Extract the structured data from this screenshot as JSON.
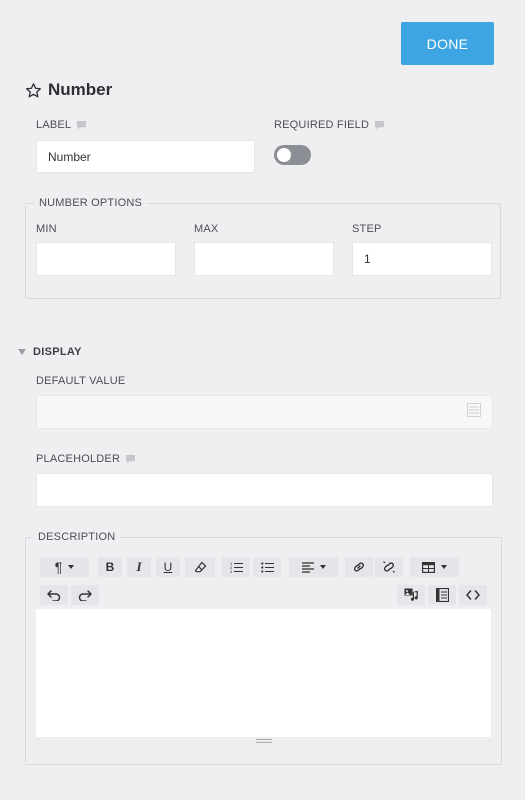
{
  "header": {
    "done_label": "DONE"
  },
  "field": {
    "title": "Number",
    "star_icon": "star-outline-icon",
    "label_caption": "LABEL",
    "label_value": "Number",
    "required_caption": "REQUIRED FIELD",
    "required_on": false
  },
  "number_options": {
    "legend": "NUMBER OPTIONS",
    "min_caption": "MIN",
    "min_value": "",
    "max_caption": "MAX",
    "max_value": "",
    "step_caption": "STEP",
    "step_value": "1"
  },
  "display": {
    "section_label": "DISPLAY",
    "default_caption": "DEFAULT VALUE",
    "default_value": "",
    "placeholder_caption": "PLACEHOLDER",
    "placeholder_value": ""
  },
  "description": {
    "legend": "DESCRIPTION",
    "toolbar": [
      "paragraph-icon",
      "bold-icon",
      "italic-icon",
      "underline-icon",
      "eraser-icon",
      "ordered-list-icon",
      "unordered-list-icon",
      "align-icon",
      "link-icon",
      "unlink-icon",
      "table-icon",
      "undo-icon",
      "redo-icon",
      "insert-media-icon",
      "insert-html-icon",
      "code-view-icon"
    ],
    "bold_glyph": "B",
    "italic_glyph": "I",
    "underline_glyph": "U",
    "content": ""
  },
  "colors": {
    "accent": "#3ea5e3",
    "background": "#efeff1",
    "toggle_off": "#8b8e94"
  }
}
